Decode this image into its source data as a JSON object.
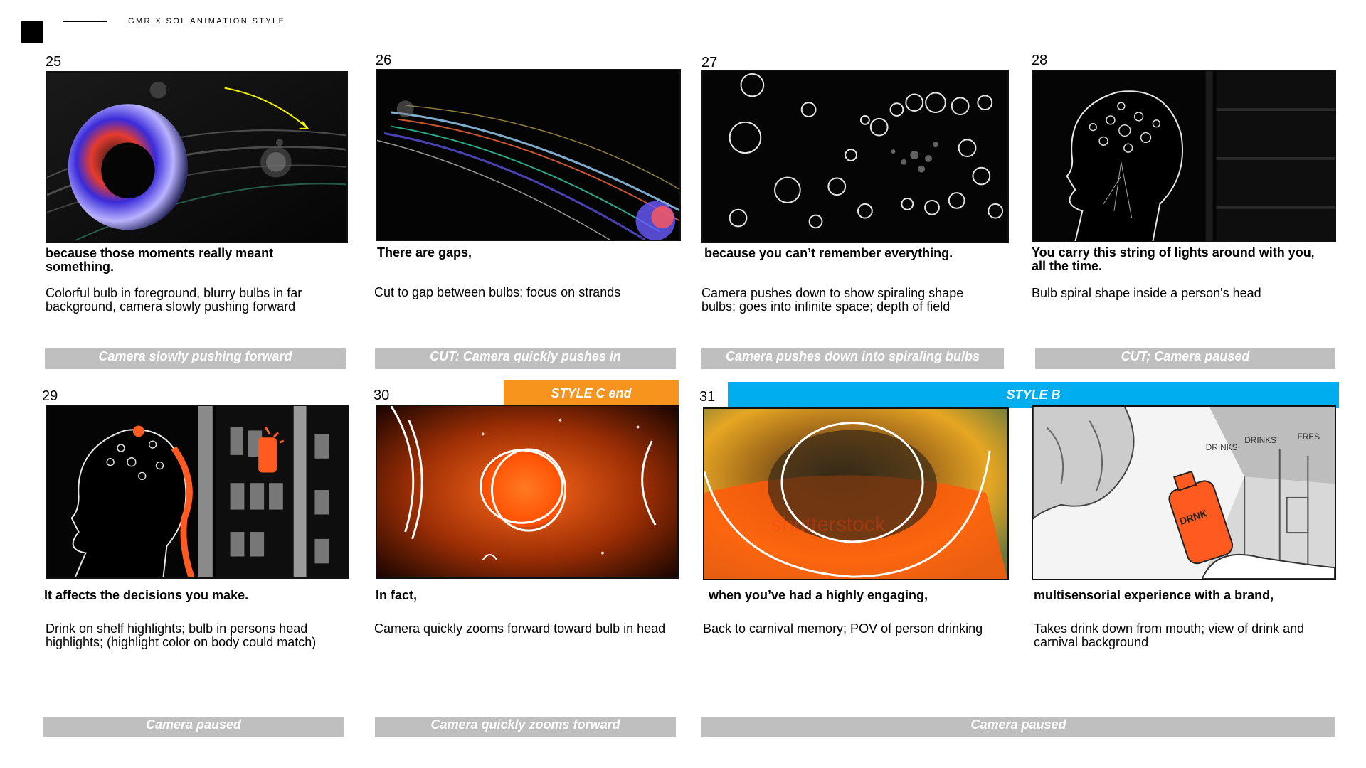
{
  "header": {
    "title": "GMR X SOL ANIMATION STYLE"
  },
  "banners": {
    "style_c": "STYLE C end",
    "style_b": "STYLE B"
  },
  "watermark": "shutterstock",
  "colors": {
    "style_c": "#f7941d",
    "style_b": "#00aeef",
    "camera_bar": "#bfbfbf"
  },
  "shots": [
    {
      "number": "25",
      "dialogue": "because those moments really meant something.",
      "description": "Colorful bulb in foreground, blurry bulbs in far background, camera slowly pushing forward",
      "camera": "Camera slowly pushing forward"
    },
    {
      "number": "26",
      "dialogue": "There are gaps,",
      "description": "Cut to gap between bulbs; focus on strands",
      "camera": "CUT: Camera quickly pushes in"
    },
    {
      "number": "27",
      "dialogue": "because you can’t remember everything.",
      "description": "Camera pushes down to show spiraling shape bulbs; goes into infinite space; depth of field",
      "camera": "Camera pushes down into spiraling bulbs"
    },
    {
      "number": "28",
      "dialogue": "You carry this string of lights around with you, all the time.",
      "description": "Bulb spiral shape inside a person's head",
      "camera": "CUT; Camera paused"
    },
    {
      "number": "29",
      "dialogue": "It affects the decisions you make.",
      "description": "Drink on shelf highlights; bulb in persons head highlights; (highlight color on body could match)",
      "camera": "Camera paused"
    },
    {
      "number": "30",
      "dialogue": "In fact,",
      "description": "Camera quickly zooms forward toward bulb in head",
      "camera": "Camera quickly zooms forward"
    },
    {
      "number": "31",
      "dialogue": "when you’ve had a highly engaging,",
      "description": "Back to carnival memory; POV of person drinking",
      "camera": "Camera paused"
    },
    {
      "number": "",
      "dialogue": "multisensorial experience with a brand,",
      "description": "Takes drink down from mouth; view of drink and carnival background",
      "camera": ""
    }
  ],
  "frame8_signs": [
    "DRINKS",
    "DRINKS",
    "FRES"
  ],
  "frame8_bottle_label": "DRNK"
}
